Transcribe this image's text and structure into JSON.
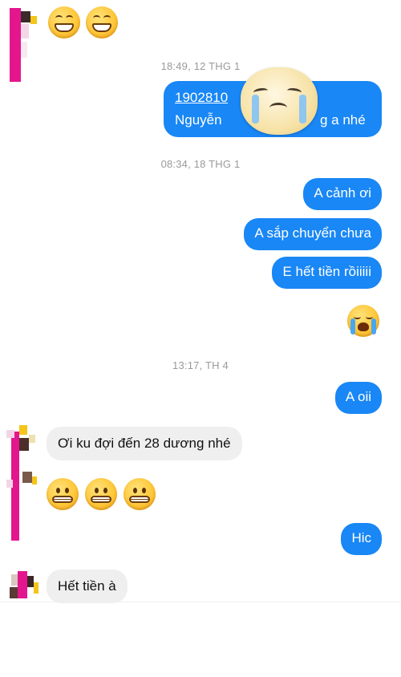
{
  "conversation": {
    "timestamps": [
      "18:49, 12 THG 1",
      "08:34, 18 THG 1",
      "13:17, TH 4"
    ],
    "messages": {
      "account_number": "1902810",
      "account_name_start": "Nguyễn",
      "account_name_end": "g a nhé",
      "msg_a_canh_oi": "A cảnh ơi",
      "msg_sap_chuyen": "A sắp chuyển chưa",
      "msg_het_tien": "E hết tiền rồiiiii",
      "msg_a_oii": "A oii",
      "msg_oi_ku": "Ơi ku đợi đến 28 dương nhé",
      "msg_hic": "Hic",
      "msg_het_tien_a": "Hết tiền à"
    }
  },
  "icons": {
    "grinning": "grinning-face-icon",
    "grimacing": "grimacing-face-icon",
    "crying": "crying-face-icon",
    "sad_sticker": "sad-sticker-icon"
  },
  "colors": {
    "outgoing_bubble": "#1987f5",
    "incoming_bubble": "#efefef",
    "timestamp_text": "#9a9a9a",
    "avatar_accent": "#e4168d"
  }
}
